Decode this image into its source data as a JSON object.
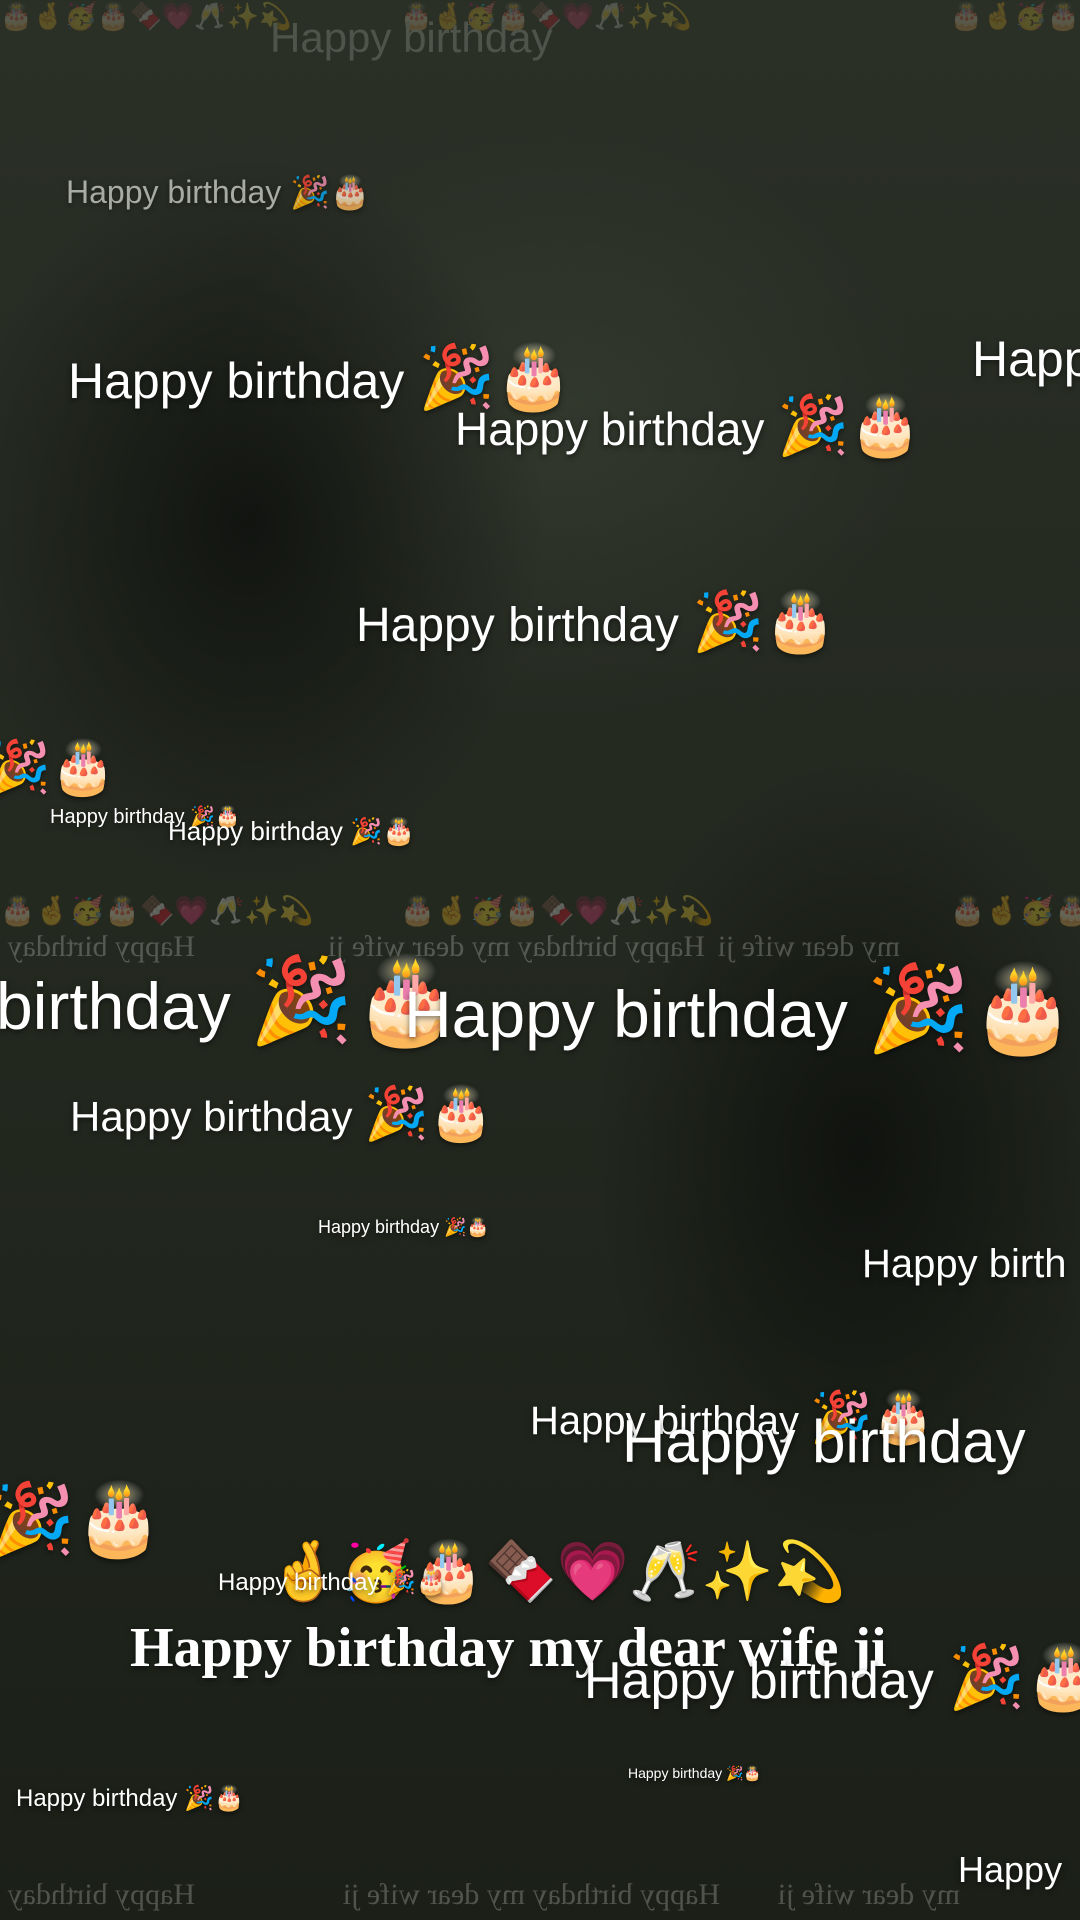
{
  "greeting": "Happy birthday",
  "wish": "Happy birthday my dear wife ji",
  "party_icon": "party-popper-icon",
  "cake_icon": "birthday-cake-icon",
  "emoji_pair": "🎉🎂",
  "emoji_line": "🤞🥳🎂🍫💗🥂✨💫",
  "left_emoji": "🎉🎂",
  "partial_texts": {
    "happ": "Happ",
    "happy": "Happy",
    "birthday": "birthday",
    "happy_birth": "Happy birth"
  },
  "mirrored_top": "Happy birthday my dear wife ji",
  "mirrored_left": "Happy birthday",
  "mirrored_right": "my dear wife ji",
  "top_emoji_strip": "🎂🤞🥳🎂🍫💗🥂✨💫",
  "colors": {
    "background": "#262b22",
    "text": "#ffffff"
  }
}
